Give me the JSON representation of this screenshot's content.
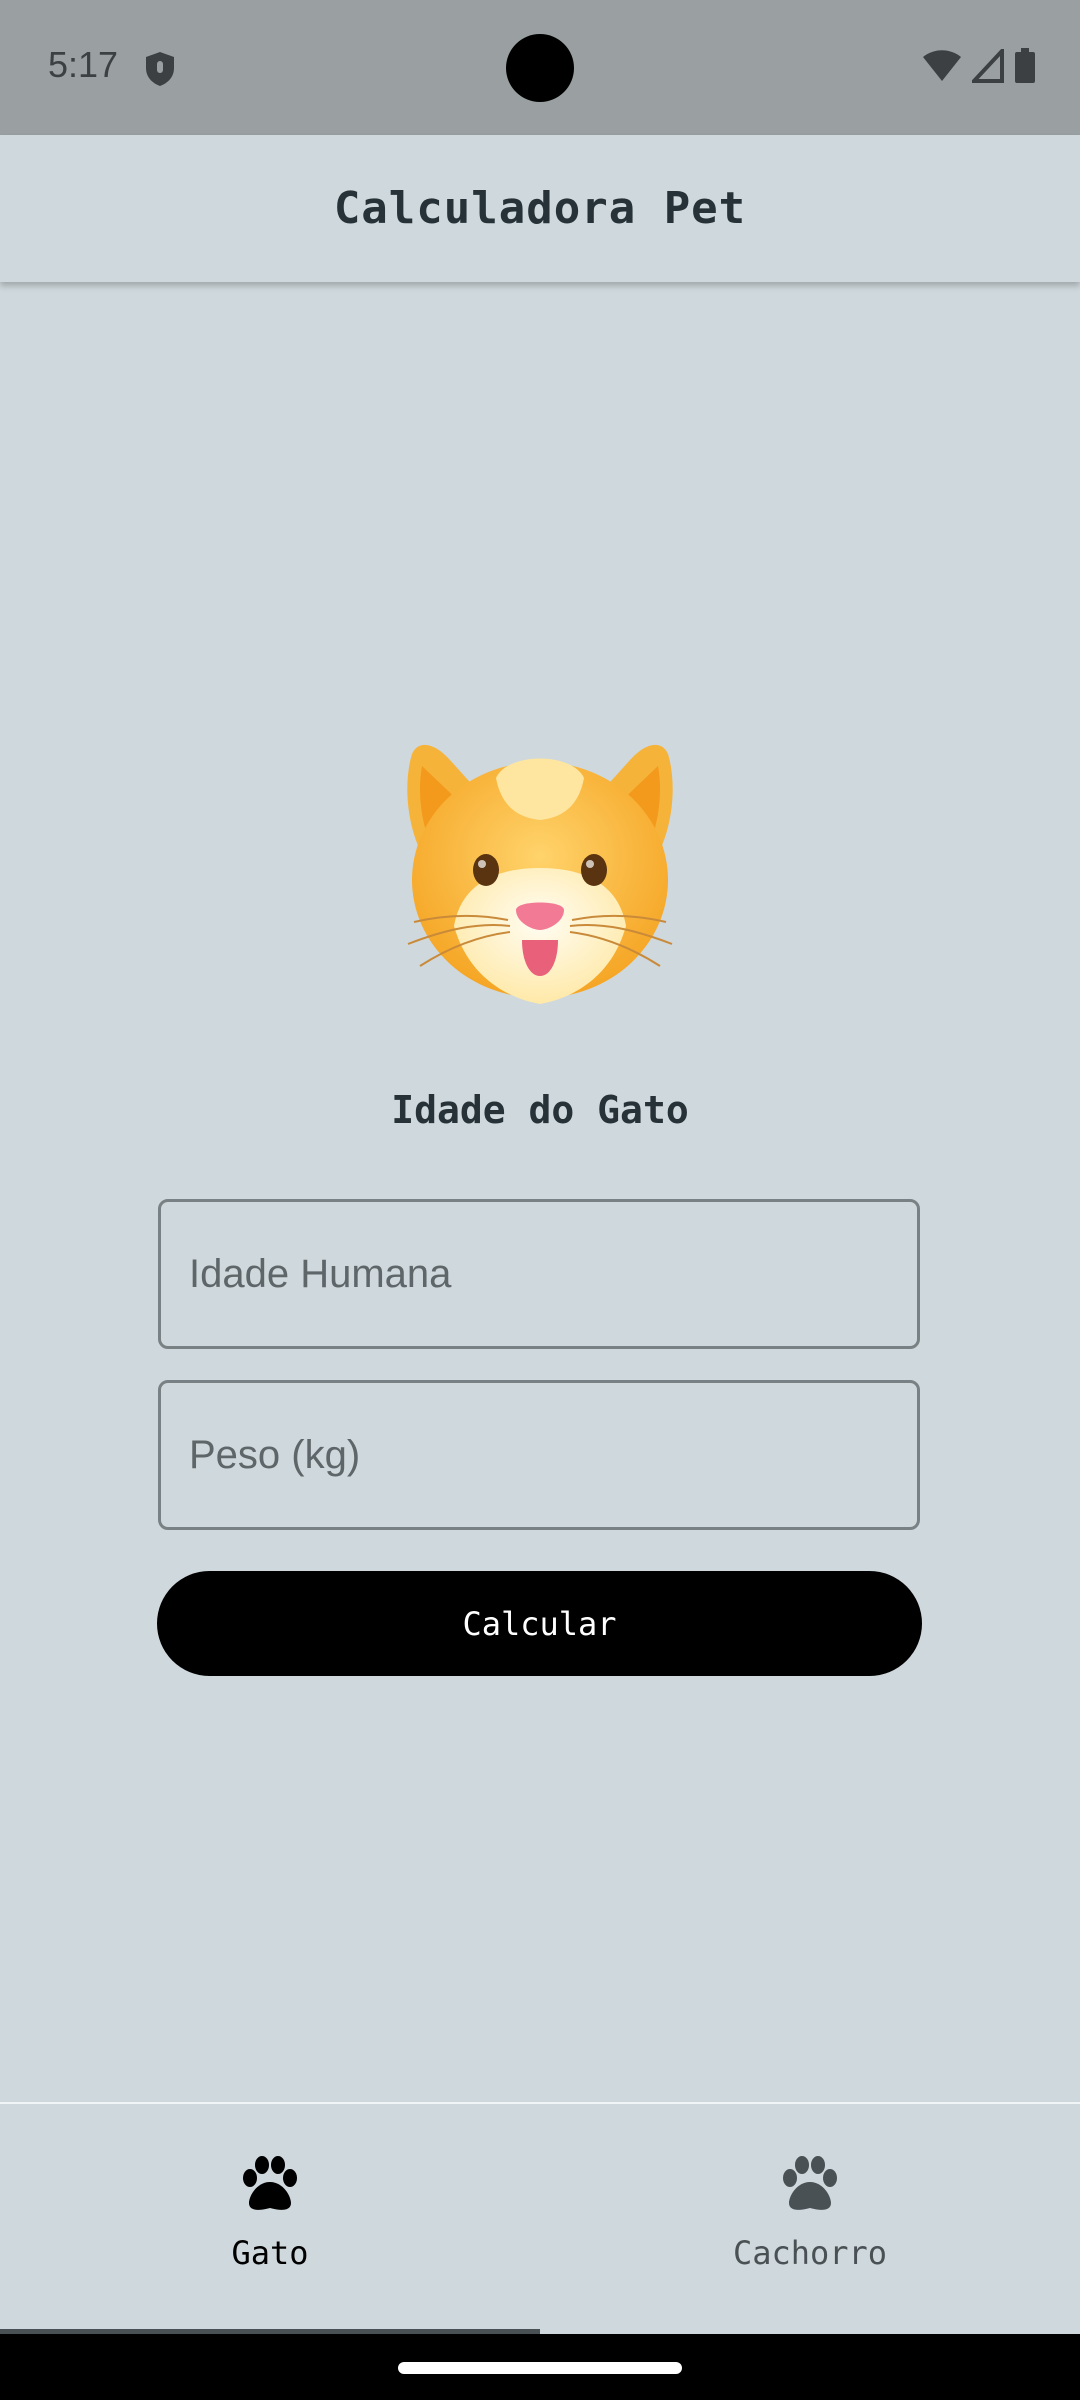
{
  "status_bar": {
    "time": "5:17",
    "icons": [
      "shield-icon",
      "wifi-icon",
      "signal-icon",
      "battery-icon"
    ]
  },
  "app_bar": {
    "title": "Calculadora Pet"
  },
  "main": {
    "image": "cat-face-emoji",
    "section_title": "Idade do Gato",
    "age_field": {
      "placeholder": "Idade Humana",
      "value": ""
    },
    "weight_field": {
      "placeholder": "Peso (kg)",
      "value": ""
    },
    "calculate_label": "Calcular"
  },
  "bottom_nav": {
    "selected": "Gato",
    "items": [
      {
        "label": "Gato",
        "icon": "paw-icon"
      },
      {
        "label": "Cachorro",
        "icon": "paw-icon"
      }
    ]
  },
  "colors": {
    "background": "#cfd8dc",
    "status_bar": "#9aa0a2",
    "button": "#000000",
    "text": "#263238"
  }
}
